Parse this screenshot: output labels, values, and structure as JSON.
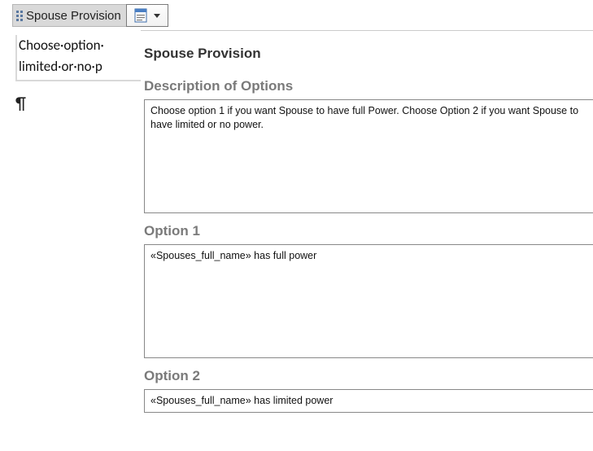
{
  "tag": {
    "title": "Spouse Provision",
    "icon": "content-control-icon"
  },
  "document": {
    "body_line1": "Choose·option·",
    "body_line2": "limited·or·no·p",
    "pilcrow": "¶"
  },
  "panel": {
    "title": "Spouse Provision",
    "description": {
      "heading": "Description of Options",
      "text": "Choose option 1 if you want Spouse to have full Power.   Choose Option 2 if you want Spouse to have limited or no power."
    },
    "option1": {
      "heading": "Option 1",
      "text": "«Spouses_full_name» has full power"
    },
    "option2": {
      "heading": "Option 2",
      "text": "«Spouses_full_name» has limited power"
    }
  }
}
